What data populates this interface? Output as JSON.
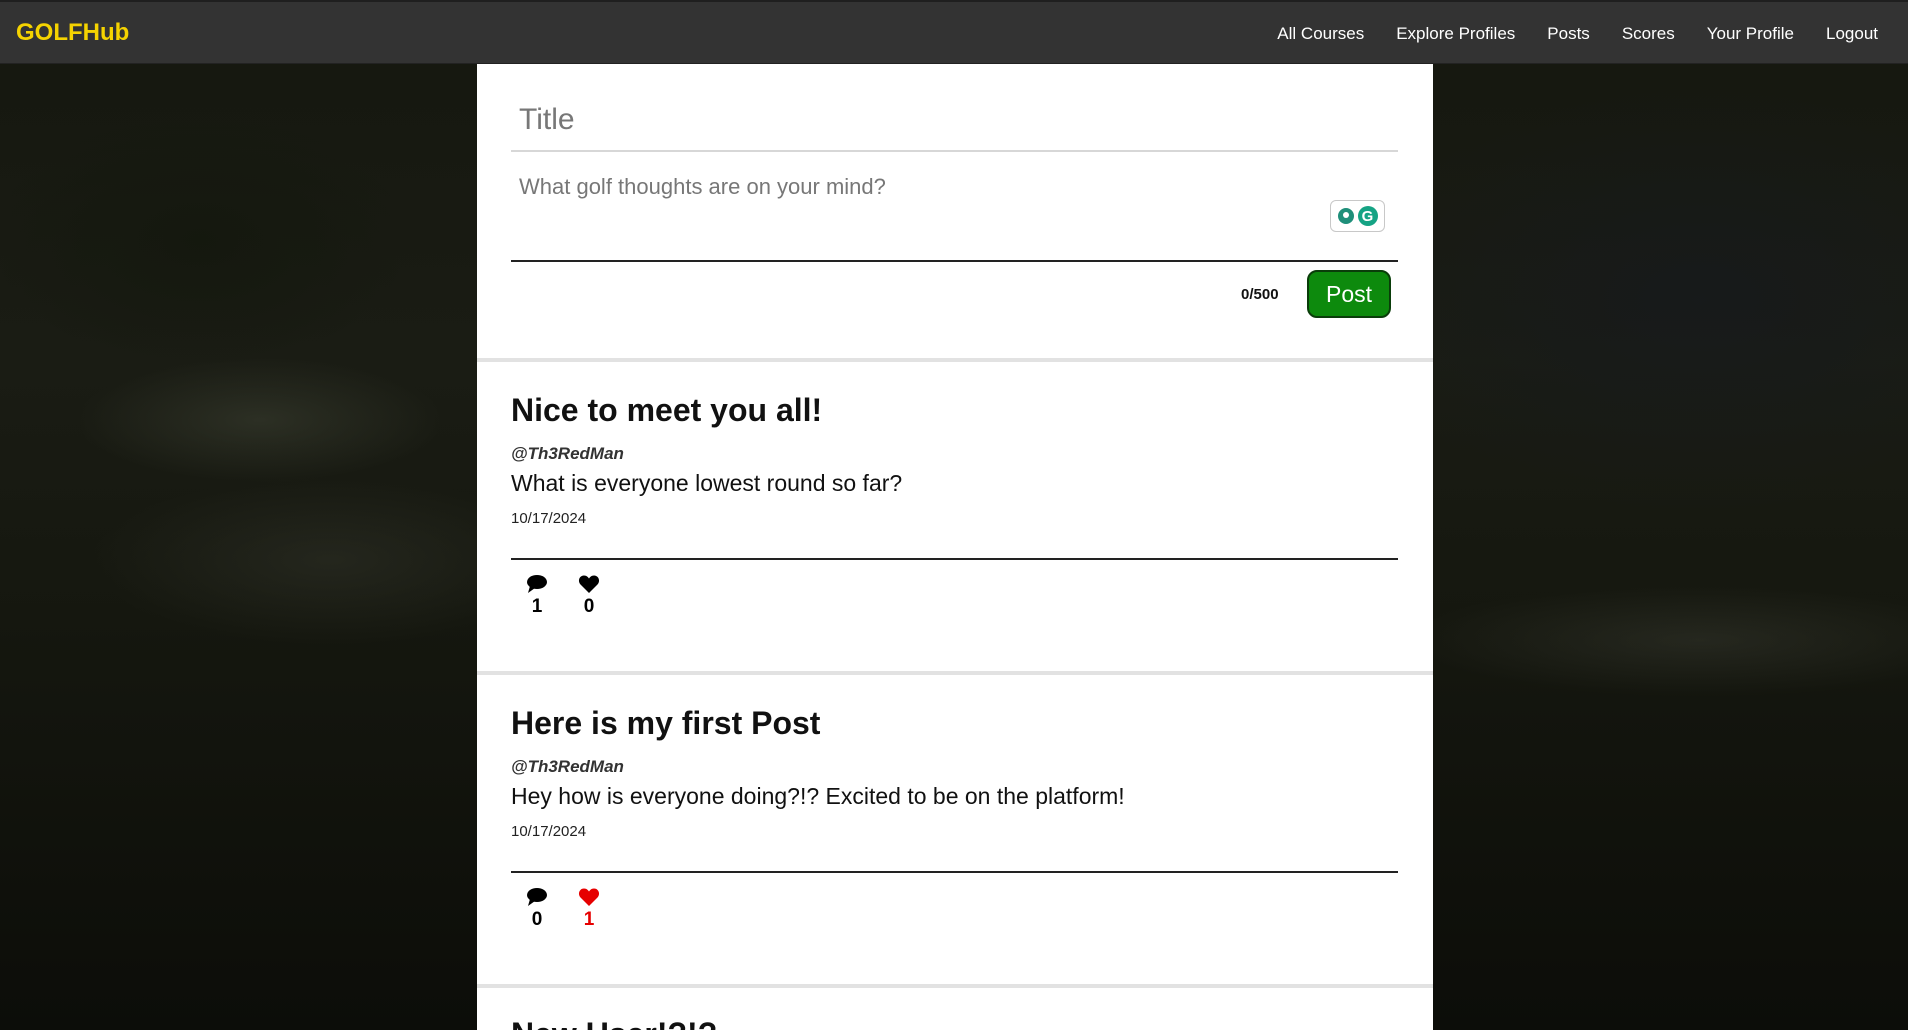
{
  "app": {
    "brand": "GOLFHub"
  },
  "nav": {
    "items": [
      {
        "label": "All Courses"
      },
      {
        "label": "Explore Profiles"
      },
      {
        "label": "Posts"
      },
      {
        "label": "Scores"
      },
      {
        "label": "Your Profile"
      },
      {
        "label": "Logout"
      }
    ]
  },
  "composer": {
    "title_placeholder": "Title",
    "title_value": "",
    "body_placeholder": "What golf thoughts are on your mind?",
    "body_value": "",
    "char_count": "0/500",
    "submit_label": "Post"
  },
  "posts": [
    {
      "title": "Nice to meet you all!",
      "handle": "@Th3RedMan",
      "body": "What is everyone lowest round so far?",
      "date": "10/17/2024",
      "comments": "1",
      "likes": "0",
      "liked": false
    },
    {
      "title": "Here is my first Post",
      "handle": "@Th3RedMan",
      "body": "Hey how is everyone doing?!? Excited to be on the platform!",
      "date": "10/17/2024",
      "comments": "0",
      "likes": "1",
      "liked": true
    },
    {
      "title": "New User!?!?"
    }
  ],
  "icons": {
    "comment": "comment-icon",
    "like": "heart-icon",
    "grammar": "grammar-assistant-icon"
  },
  "colors": {
    "brand": "#f5d300",
    "nav_bg": "#333333",
    "post_button": "#0d8a0d",
    "liked": "#e60000"
  }
}
